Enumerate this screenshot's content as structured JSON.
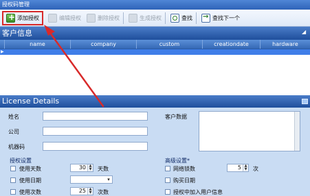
{
  "window": {
    "title": "授权码管理"
  },
  "toolbar": {
    "add": "添加授权",
    "edit": "编辑授权",
    "delete": "删除授权",
    "generate": "生成授权",
    "find": "查找",
    "find_next": "查找下一个"
  },
  "customer": {
    "header": "客户信息",
    "columns": [
      "name",
      "company",
      "custom",
      "creationdate",
      "hardware"
    ]
  },
  "license": {
    "header": "License Details",
    "fields": {
      "name_label": "姓名",
      "company_label": "公司",
      "machine_label": "机器码",
      "customer_data_label": "客户数据"
    },
    "auth_settings": {
      "title": "授权设置",
      "use_days": "使用天数",
      "days_value": "30",
      "days_unit": "天数",
      "use_date": "使用日期",
      "use_count": "使用次数",
      "count_value": "25",
      "count_unit": "次数"
    },
    "advanced_settings": {
      "title": "高级设置*",
      "network_lock": "网络锁数",
      "network_value": "5",
      "network_unit": "次",
      "purchase_date": "购买日期",
      "add_user_info": "授权中加入用户信息"
    }
  },
  "colors": {
    "highlight": "#d82a2a",
    "header_blue": "#1f4f9c"
  }
}
